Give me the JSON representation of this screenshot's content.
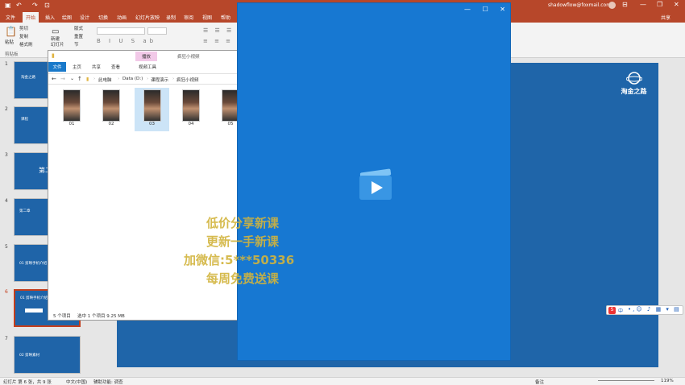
{
  "ppt": {
    "account": "shadowflow@foxmail.com",
    "share_label": "共享",
    "tabs": [
      "文件",
      "开始",
      "插入",
      "绘图",
      "设计",
      "切换",
      "动画",
      "幻灯片放映",
      "录制",
      "审阅",
      "视图",
      "帮助"
    ],
    "active_tab": "开始",
    "ribbon": {
      "paste": "粘贴",
      "cut": "剪切",
      "copy": "复制",
      "format_painter": "格式刷",
      "clipboard_group": "剪贴板",
      "new_slide": "新建\n幻灯片",
      "layout": "版式",
      "reset": "重置",
      "section": "节"
    },
    "thumbnails": [
      {
        "num": "1",
        "text": "淘金之路"
      },
      {
        "num": "2",
        "text": "课程"
      },
      {
        "num": "3",
        "text": "第二"
      },
      {
        "num": "4",
        "text": "第二章"
      },
      {
        "num": "5",
        "text": "01 剪映手机介绍"
      },
      {
        "num": "6",
        "text": "01 剪映手机介绍"
      },
      {
        "num": "7",
        "text": "02 剪映素材"
      }
    ],
    "selected_thumbnail": "6",
    "slide_logo_text": "淘金之路",
    "statusbar": {
      "slide_info": "幻灯片 第 6 张，共 9 张",
      "language": "中文(中国)",
      "accessibility": "辅助功能: 调查",
      "notes": "备注",
      "zoom": "119%"
    }
  },
  "explorer": {
    "context_tab": "播放",
    "title": "疯狂小视频",
    "tabs": [
      "文件",
      "主页",
      "共享",
      "查看",
      "视频工具"
    ],
    "breadcrumb": [
      "此电脑",
      "Data (D:)",
      "课程演示",
      "疯狂小视频"
    ],
    "files": [
      {
        "name": "01"
      },
      {
        "name": "02"
      },
      {
        "name": "03"
      },
      {
        "name": "04"
      },
      {
        "name": "05"
      }
    ],
    "selected_file": "03",
    "status_count": "5 个项目",
    "status_selected": "选中 1 个项目  9.25 MB"
  },
  "player": {
    "minimize": "—",
    "maximize": "☐",
    "close": "✕"
  },
  "watermark": {
    "line1": "低价分享新课",
    "line2": "更新一手新课",
    "line3": "加微信:5***50336",
    "line4": "每周免费送课"
  },
  "ime": {
    "label": "中"
  },
  "colors": {
    "ppt_accent": "#b7472a",
    "slide_bg": "#1f65a9",
    "player_bg": "#1778d2"
  }
}
